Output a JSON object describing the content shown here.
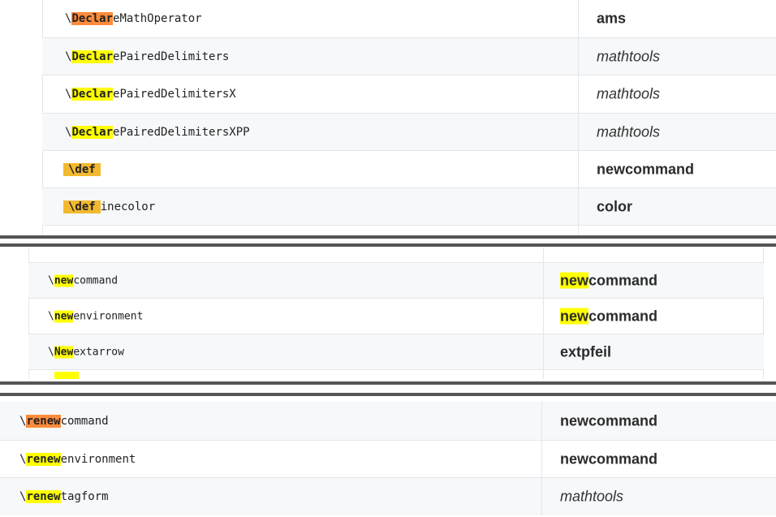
{
  "section1": {
    "rows": [
      {
        "prefix": "\\",
        "hl": "Declar",
        "hl_style": "orange",
        "rest": "eMathOperator",
        "pkg": "ams",
        "pkg_style": "bold"
      },
      {
        "prefix": "\\",
        "hl": "Declar",
        "hl_style": "yellow",
        "rest": "ePairedDelimiters",
        "pkg": "mathtools",
        "pkg_style": "italic"
      },
      {
        "prefix": "\\",
        "hl": "Declar",
        "hl_style": "yellow",
        "rest": "ePairedDelimitersX",
        "pkg": "mathtools",
        "pkg_style": "italic"
      },
      {
        "prefix": "\\",
        "hl": "Declar",
        "hl_style": "yellow",
        "rest": "ePairedDelimitersXPP",
        "pkg": "mathtools",
        "pkg_style": "italic"
      },
      {
        "prefix": "",
        "hl": "\\def",
        "hl_style": "gold",
        "rest": "",
        "pkg": "newcommand",
        "pkg_style": "bold"
      },
      {
        "prefix": "",
        "hl": "\\def",
        "hl_style": "gold",
        "rest": "inecolor",
        "pkg": "color",
        "pkg_style": "bold"
      }
    ]
  },
  "section2": {
    "rows": [
      {
        "prefix": "\\",
        "hl": "new",
        "hl_style": "yellow",
        "rest": "command",
        "pkg_hl": "new",
        "pkg": "command",
        "pkg_style": "bold"
      },
      {
        "prefix": "\\",
        "hl": "new",
        "hl_style": "yellow",
        "rest": "environment",
        "pkg_hl": "new",
        "pkg": "command",
        "pkg_style": "bold"
      },
      {
        "prefix": "\\",
        "hl": "New",
        "hl_style": "yellow",
        "rest": "extarrow",
        "pkg_hl": "",
        "pkg": "extpfeil",
        "pkg_style": "bold"
      }
    ]
  },
  "section3": {
    "rows": [
      {
        "prefix": "\\",
        "hl": "renew",
        "hl_style": "orange",
        "rest": "command",
        "pkg": "newcommand",
        "pkg_style": "bold"
      },
      {
        "prefix": "\\",
        "hl": "renew",
        "hl_style": "yellow",
        "rest": "environment",
        "pkg": "newcommand",
        "pkg_style": "bold"
      },
      {
        "prefix": "\\",
        "hl": "renew",
        "hl_style": "yellow",
        "rest": "tagform",
        "pkg": "mathtools",
        "pkg_style": "italic"
      }
    ]
  }
}
